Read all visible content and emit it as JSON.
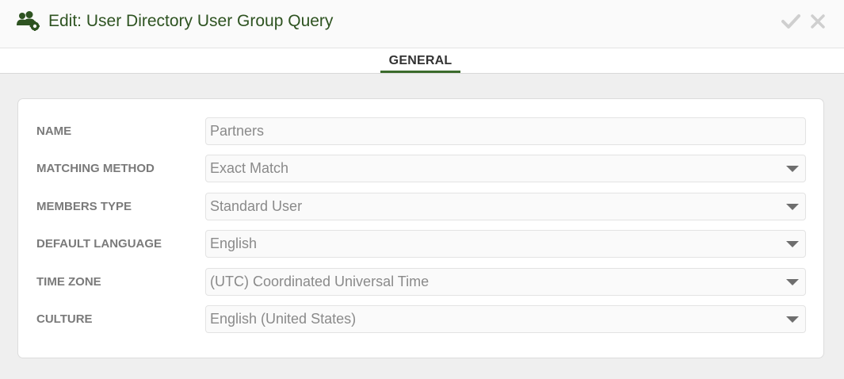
{
  "header": {
    "icon": "user-group-icon",
    "title": "Edit: User Directory User Group Query",
    "save_icon": "checkmark-icon",
    "close_icon": "close-icon",
    "brand_color": "#2e5321"
  },
  "tabs": [
    {
      "label": "GENERAL",
      "active": true
    }
  ],
  "form": {
    "name": {
      "label": "NAME",
      "value": "Partners"
    },
    "matching_method": {
      "label": "MATCHING METHOD",
      "value": "Exact Match"
    },
    "members_type": {
      "label": "MEMBERS TYPE",
      "value": "Standard User"
    },
    "default_language": {
      "label": "DEFAULT LANGUAGE",
      "value": "English"
    },
    "time_zone": {
      "label": "TIME ZONE",
      "value": "(UTC) Coordinated Universal Time"
    },
    "culture": {
      "label": "CULTURE",
      "value": "English (United States)"
    }
  }
}
